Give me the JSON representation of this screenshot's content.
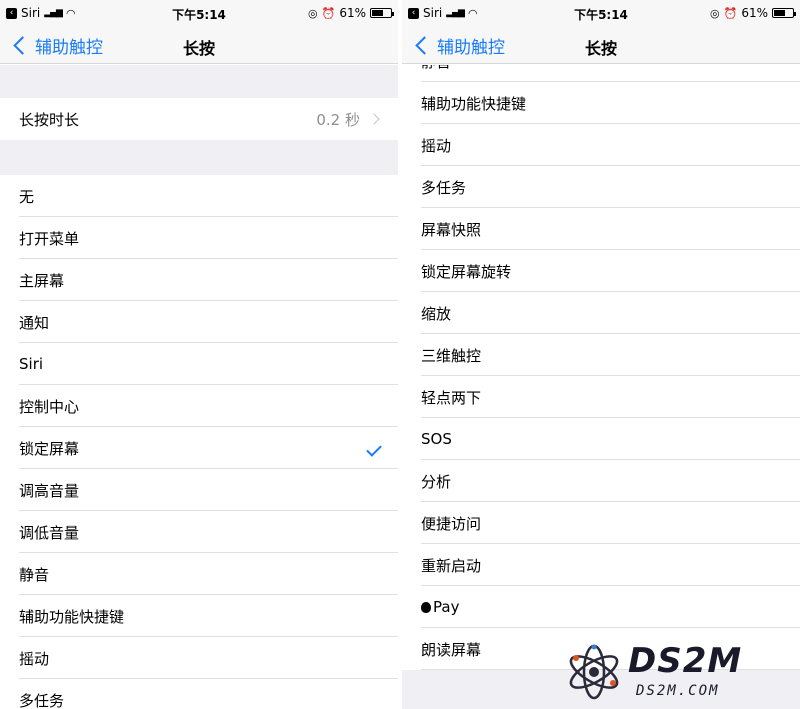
{
  "status_bar": {
    "carrier": "Siri",
    "time": "下午5:14",
    "battery": "61%",
    "battery_level": 0.61
  },
  "nav": {
    "back_label": "辅助触控",
    "title": "长按"
  },
  "duration": {
    "label": "长按时长",
    "value": "0.2 秒"
  },
  "left_options": [
    {
      "label": "无"
    },
    {
      "label": "打开菜单"
    },
    {
      "label": "主屏幕"
    },
    {
      "label": "通知"
    },
    {
      "label": "Siri"
    },
    {
      "label": "控制中心"
    },
    {
      "label": "锁定屏幕",
      "checked": true
    },
    {
      "label": "调高音量"
    },
    {
      "label": "调低音量"
    },
    {
      "label": "静音"
    },
    {
      "label": "辅助功能快捷键"
    },
    {
      "label": "摇动"
    },
    {
      "label": "多任务"
    }
  ],
  "right_options": [
    {
      "label": "静音"
    },
    {
      "label": "辅助功能快捷键"
    },
    {
      "label": "摇动"
    },
    {
      "label": "多任务"
    },
    {
      "label": "屏幕快照"
    },
    {
      "label": "锁定屏幕旋转"
    },
    {
      "label": "缩放"
    },
    {
      "label": "三维触控"
    },
    {
      "label": "轻点两下"
    },
    {
      "label": "SOS"
    },
    {
      "label": "分析"
    },
    {
      "label": "便捷访问"
    },
    {
      "label": "重新启动"
    },
    {
      "label": "Pay",
      "icon": "apple-icon"
    },
    {
      "label": "朗读屏幕"
    }
  ],
  "watermark": {
    "title": "DS2M",
    "subtitle": "DS2M.COM"
  },
  "colors": {
    "accent": "#1a7cf6",
    "group_bg": "#efeff4",
    "separator": "#e0e0e0",
    "secondary_text": "#8e8e93"
  }
}
